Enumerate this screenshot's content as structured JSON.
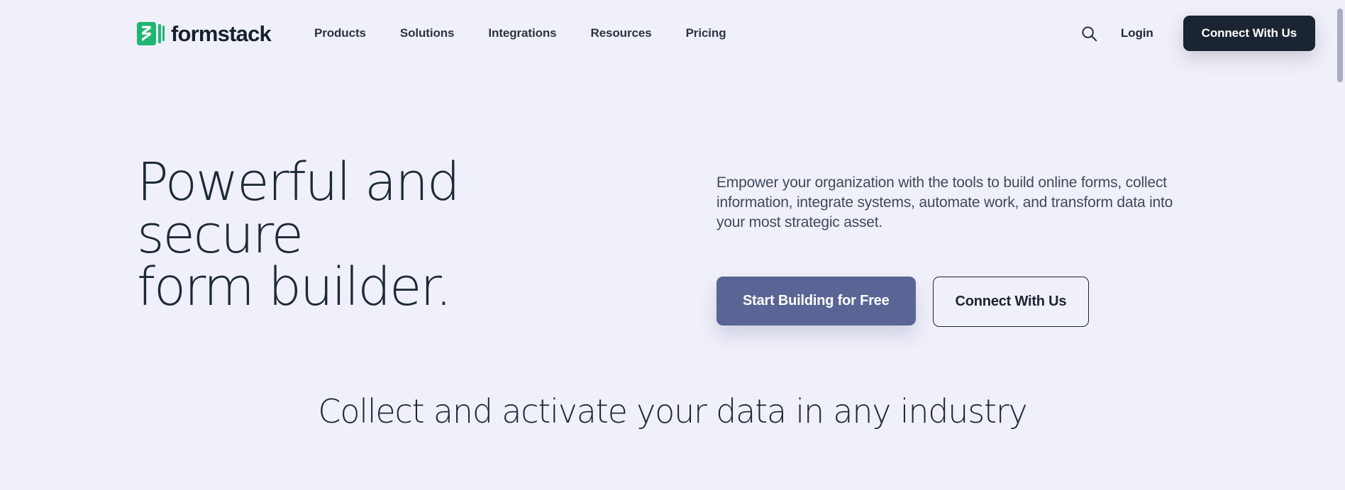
{
  "colors": {
    "page_background": "#f0f0fa",
    "brand_green": "#21b573",
    "dark_navy": "#1b2431",
    "primary_button": "#5a6596",
    "heading_text": "#1c2a36",
    "body_text": "#3e4a5b"
  },
  "header": {
    "brand": {
      "wordmark": "formstack",
      "mark_icon": "formstack-bolt-icon"
    },
    "nav": [
      {
        "label": "Products"
      },
      {
        "label": "Solutions"
      },
      {
        "label": "Integrations"
      },
      {
        "label": "Resources"
      },
      {
        "label": "Pricing"
      }
    ],
    "search_icon": "search-icon",
    "login_label": "Login",
    "cta_label": "Connect With Us"
  },
  "hero": {
    "title": "Powerful and secure\nform builder.",
    "lede": "Empower your organization with the tools to build online forms, collect information, integrate systems, automate work, and transform data into your most strategic asset.",
    "primary_cta": "Start Building for Free",
    "secondary_cta": "Connect With Us"
  },
  "industry": {
    "title": "Collect and activate your data in any industry"
  }
}
